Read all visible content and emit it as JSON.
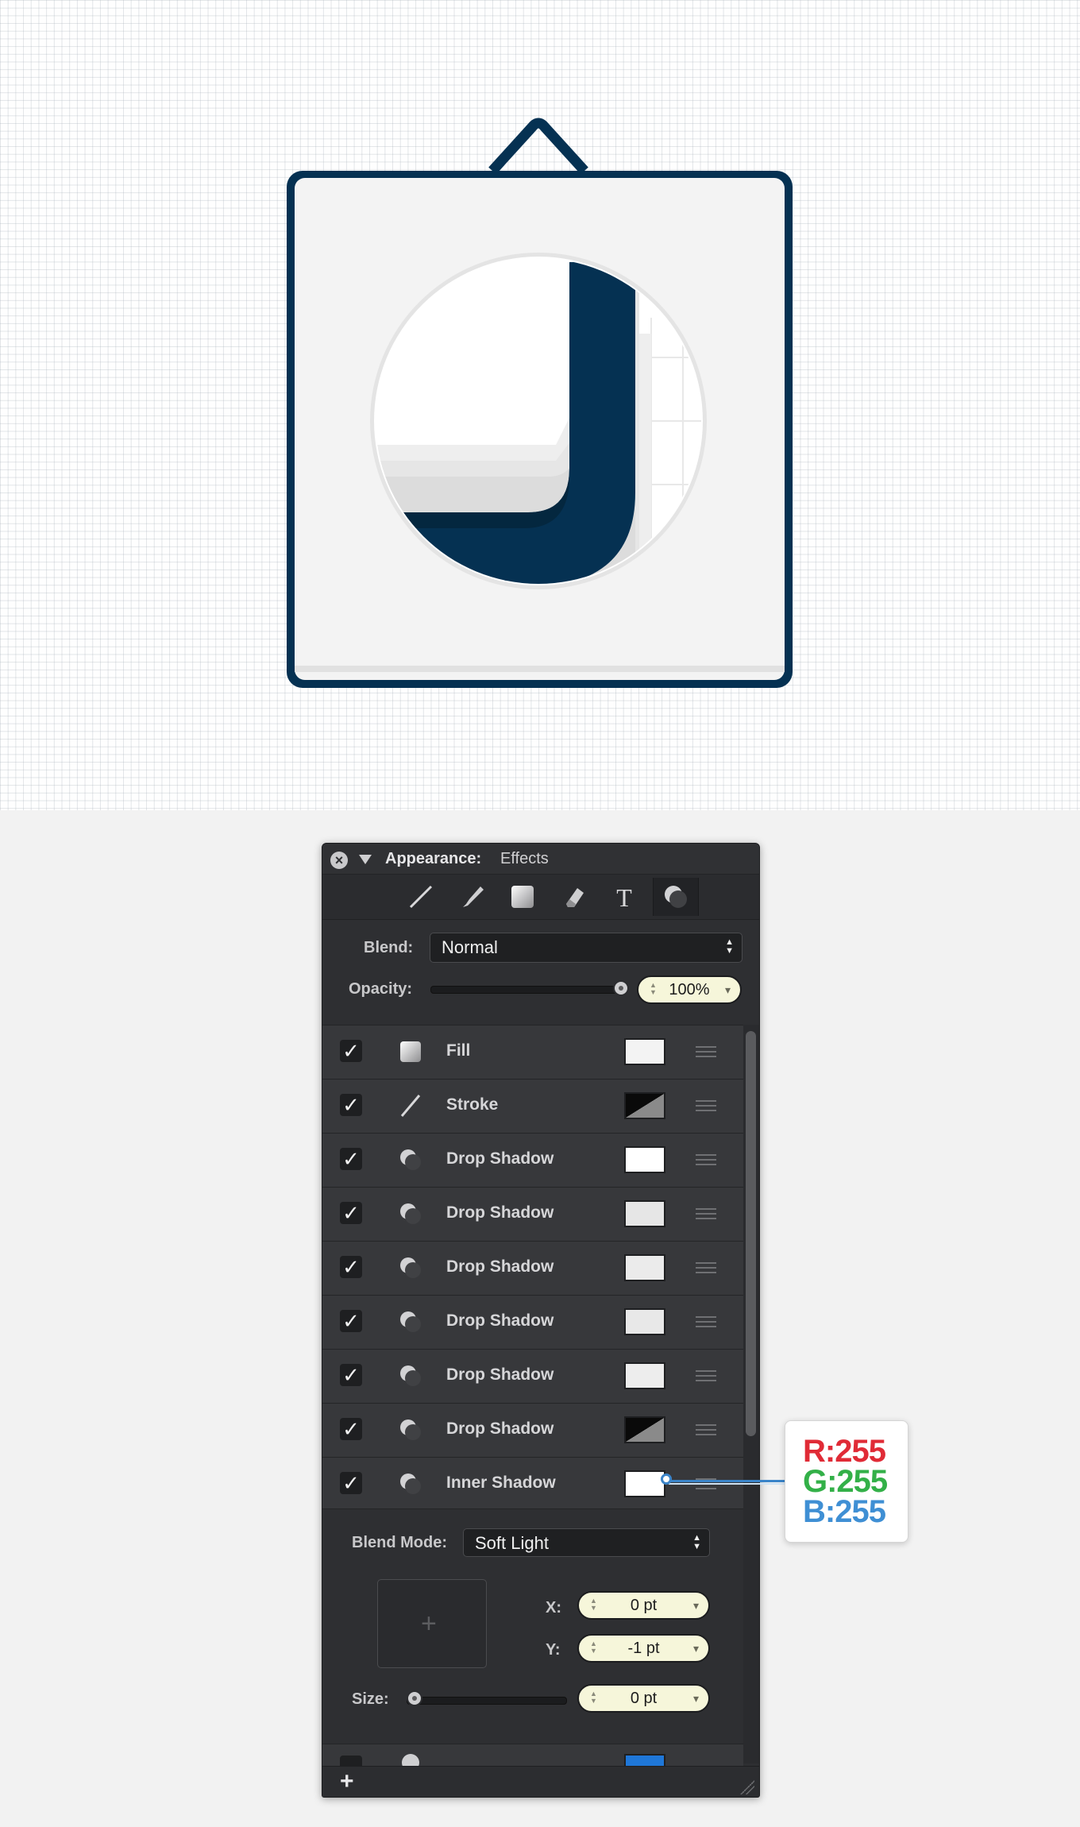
{
  "panel": {
    "title_label": "Appearance:",
    "title_value": "Effects",
    "tabs": [
      "stroke-tab-icon",
      "brush-tab-icon",
      "fill-tab-icon",
      "eraser-tab-icon",
      "text-tab-icon",
      "effects-tab-icon"
    ],
    "active_tab": "effects",
    "blend_label": "Blend:",
    "blend_value": "Normal",
    "opacity_label": "Opacity:",
    "opacity_value": "100%",
    "opacity_level": 1.0,
    "effects": [
      {
        "label": "Fill",
        "icon": "fill-swatch-icon",
        "swatch": "#f3f3f3",
        "checked": true
      },
      {
        "label": "Stroke",
        "icon": "stroke-line-icon",
        "swatch": "split-black-gray",
        "checked": true
      },
      {
        "label": "Drop Shadow",
        "icon": "shadow-icon",
        "swatch": "#ffffff",
        "checked": true
      },
      {
        "label": "Drop Shadow",
        "icon": "shadow-icon",
        "swatch": "#e6e6e6",
        "checked": true
      },
      {
        "label": "Drop Shadow",
        "icon": "shadow-icon",
        "swatch": "#ebebeb",
        "checked": true
      },
      {
        "label": "Drop Shadow",
        "icon": "shadow-icon",
        "swatch": "#e8e8e8",
        "checked": true
      },
      {
        "label": "Drop Shadow",
        "icon": "shadow-icon",
        "swatch": "#ededed",
        "checked": true
      },
      {
        "label": "Drop Shadow",
        "icon": "shadow-icon",
        "swatch": "split-black-gray",
        "checked": true
      },
      {
        "label": "Inner Shadow",
        "icon": "shadow-icon",
        "swatch": "#ffffff",
        "checked": true
      }
    ],
    "detail": {
      "blend_mode_label": "Blend Mode:",
      "blend_mode_value": "Soft Light",
      "x_label": "X:",
      "x_value": "0 pt",
      "y_label": "Y:",
      "y_value": "-1 pt",
      "size_label": "Size:",
      "size_value": "0 pt",
      "size_level": 0
    },
    "add_button": "+"
  },
  "callout": {
    "r": "R:255",
    "g": "G:255",
    "b": "B:255"
  },
  "colors": {
    "navy": "#053152",
    "panel_bg": "#2e2f32",
    "stepper_bg": "#f6f6da",
    "red": "#e02b36",
    "green": "#33b048",
    "blue": "#3f8fd4"
  }
}
